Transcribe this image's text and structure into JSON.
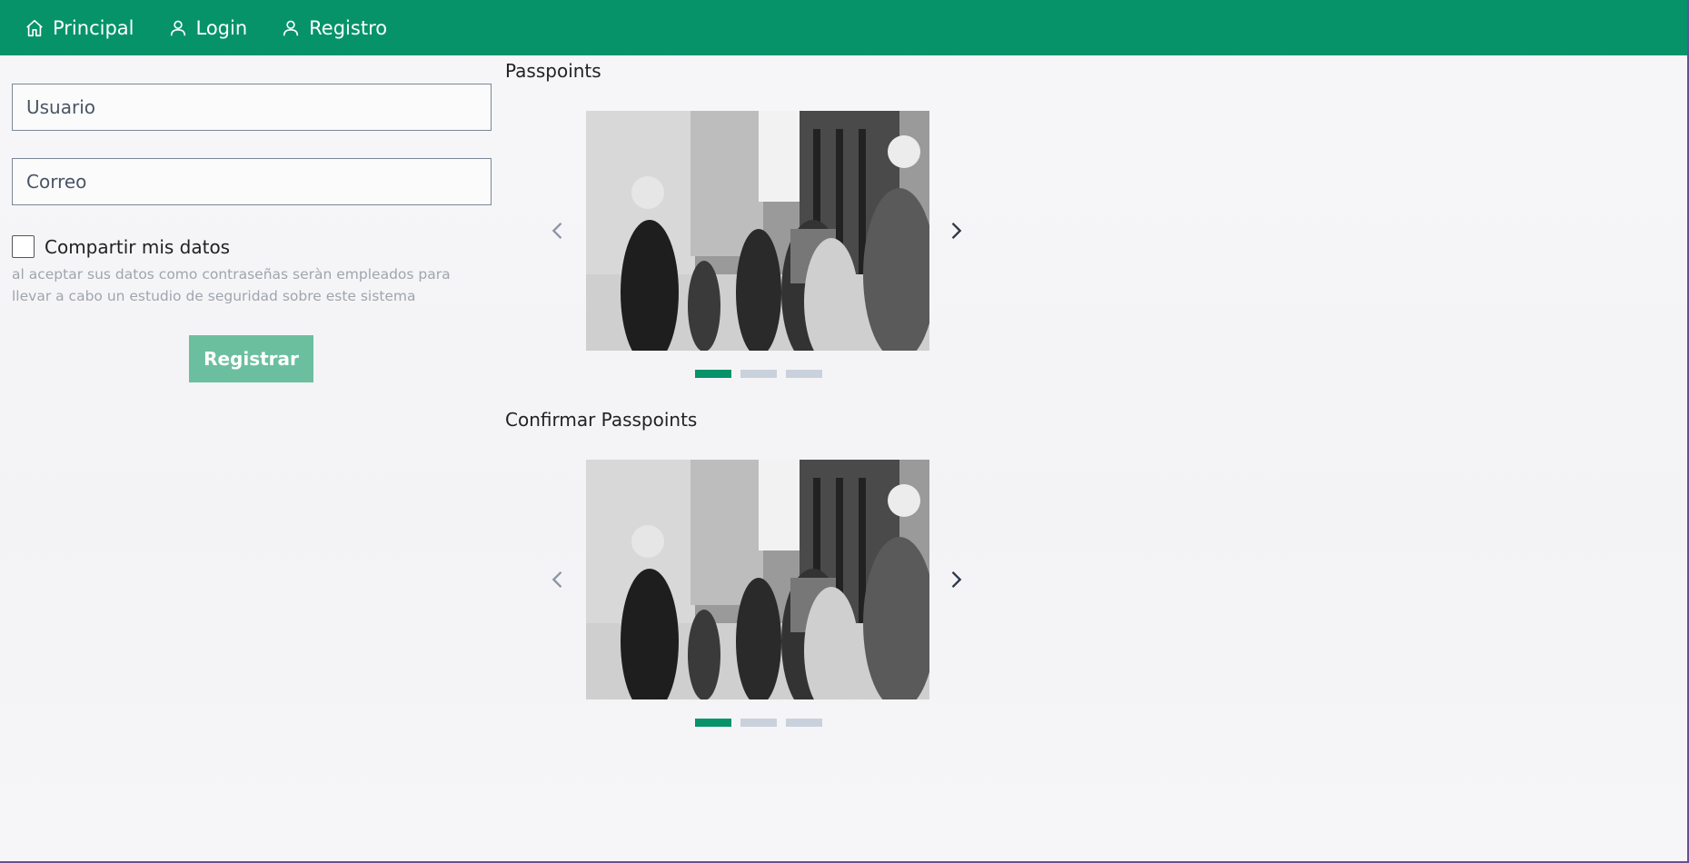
{
  "nav": {
    "items": [
      {
        "label": "Principal",
        "icon": "home-icon"
      },
      {
        "label": "Login",
        "icon": "user-icon"
      },
      {
        "label": "Registro",
        "icon": "user-icon"
      }
    ]
  },
  "form": {
    "username_placeholder": "Usuario",
    "email_placeholder": "Correo",
    "share_label": "Compartir mis datos",
    "share_checked": false,
    "help_text": "al aceptar sus datos como contraseñas seràn empleados para llevar a cabo un estudio de seguridad sobre este sistema",
    "submit_label": "Registrar"
  },
  "carousels": [
    {
      "title": "Passpoints",
      "slides": 3,
      "active_slide": 1
    },
    {
      "title": "Confirmar Passpoints",
      "slides": 3,
      "active_slide": 1
    }
  ],
  "colors": {
    "nav_bg": "#06936a",
    "submit_bg": "#6bbf9f",
    "dot_active": "#06936a",
    "dot_inactive": "#c9d1dc"
  }
}
